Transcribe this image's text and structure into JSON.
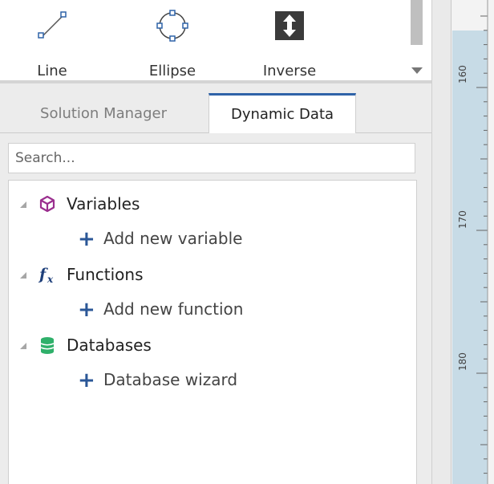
{
  "toolbar": {
    "tools": [
      {
        "label": "Line",
        "icon": "line-tool-icon"
      },
      {
        "label": "Ellipse",
        "icon": "ellipse-tool-icon"
      },
      {
        "label": "Inverse",
        "icon": "inverse-tool-icon"
      }
    ]
  },
  "tabs": {
    "solution_manager": "Solution Manager",
    "dynamic_data": "Dynamic Data",
    "active": "Dynamic Data"
  },
  "search": {
    "placeholder": "Search..."
  },
  "tree": {
    "variables": {
      "label": "Variables",
      "icon": "cube-icon",
      "child": "Add new variable"
    },
    "functions": {
      "label": "Functions",
      "icon": "function-fx-icon",
      "child": "Add new function"
    },
    "databases": {
      "label": "Databases",
      "icon": "database-icon",
      "child": "Database wizard"
    }
  },
  "ruler": {
    "labels": [
      "160",
      "170",
      "180"
    ]
  },
  "colors": {
    "accent": "#2f63a8",
    "plus": "#2b5797",
    "variables_icon": "#9b2f8f",
    "databases_icon": "#2fb06a",
    "ruler_band": "#c7dbe6"
  }
}
